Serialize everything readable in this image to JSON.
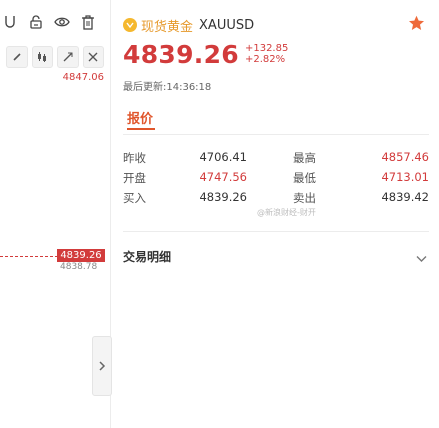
{
  "left_panel": {
    "top_price": "4847.06",
    "current_price_tag": "4839.26",
    "prev_price_tag": "4838.78",
    "collapse_icon": "›"
  },
  "header": {
    "badge": "∑",
    "instrument_name": "现货黄金",
    "symbol": "XAUUSD"
  },
  "price": {
    "last": "4839.26",
    "change": "+132.85",
    "change_pct": "+2.82%",
    "update_time": "最后更新:14:36:18"
  },
  "tabs": [
    {
      "label": "报价"
    }
  ],
  "quote": {
    "rows": [
      {
        "l1": "昨收",
        "v1": "4706.41",
        "l2": "最高",
        "v2": "4857.46"
      },
      {
        "l1": "开盘",
        "v1": "4747.56",
        "l2": "最低",
        "v2": "4713.01"
      },
      {
        "l1": "买入",
        "v1": "4839.26",
        "l2": "卖出",
        "v2": "4839.42"
      }
    ]
  },
  "watermark": "@新浪财经-财开",
  "trade_detail": {
    "title": "交易明细"
  },
  "colors": {
    "up": "#d23b3b",
    "accent": "#e0562c",
    "gold": "#e6992b"
  }
}
